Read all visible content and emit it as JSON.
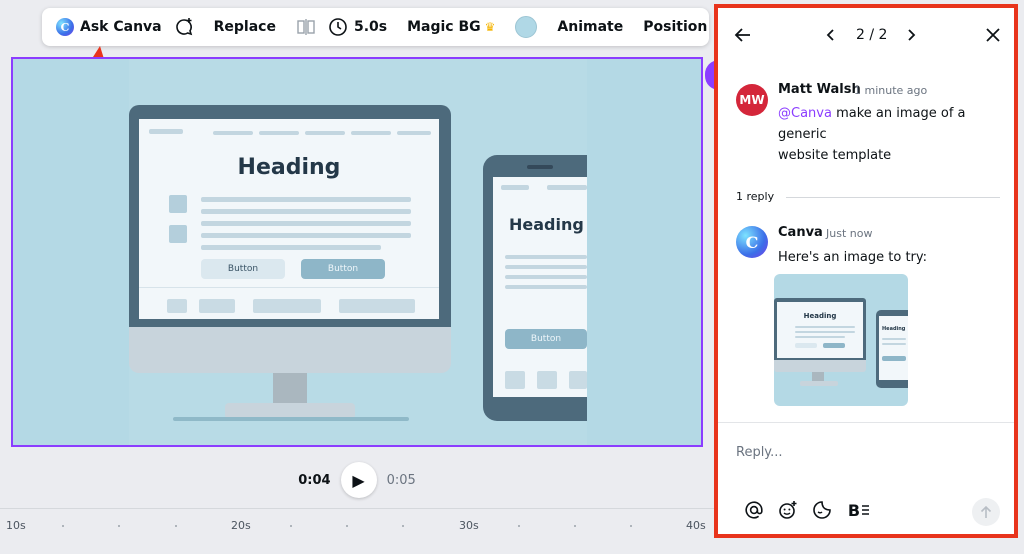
{
  "toolbar": {
    "ask_canva": "Ask Canva",
    "replace": "Replace",
    "duration": "5.0s",
    "magic_bg": "Magic BG",
    "crown": "♛",
    "animate": "Animate",
    "position": "Position",
    "color": "#b0d8e6"
  },
  "canvas": {
    "monitor_heading": "Heading",
    "monitor_button_1": "Button",
    "monitor_button_2": "Button",
    "phone_heading": "Heading",
    "phone_button": "Button"
  },
  "playback": {
    "current": "0:04",
    "end": "0:05"
  },
  "timeline": {
    "labels": [
      "10s",
      "20s",
      "30s",
      "40s"
    ]
  },
  "panel": {
    "pager": "2 / 2",
    "comment": {
      "initials": "MW",
      "author": "Matt Walsh",
      "time": "1 minute ago",
      "mention": "@Canva",
      "text_line1": " make an image of a generic",
      "text_line2": "website template"
    },
    "reply_count": "1 reply",
    "reply": {
      "author": "Canva",
      "time": "Just now",
      "text": "Here's an image to try:",
      "thumb_heading": "Heading",
      "thumb_phone_heading": "Heading"
    },
    "reply_placeholder": "Reply...",
    "format_label": "B"
  },
  "colors": {
    "accent": "#8b3dff",
    "annotation": "#e8341c",
    "avatar_mw": "#d4263a"
  }
}
